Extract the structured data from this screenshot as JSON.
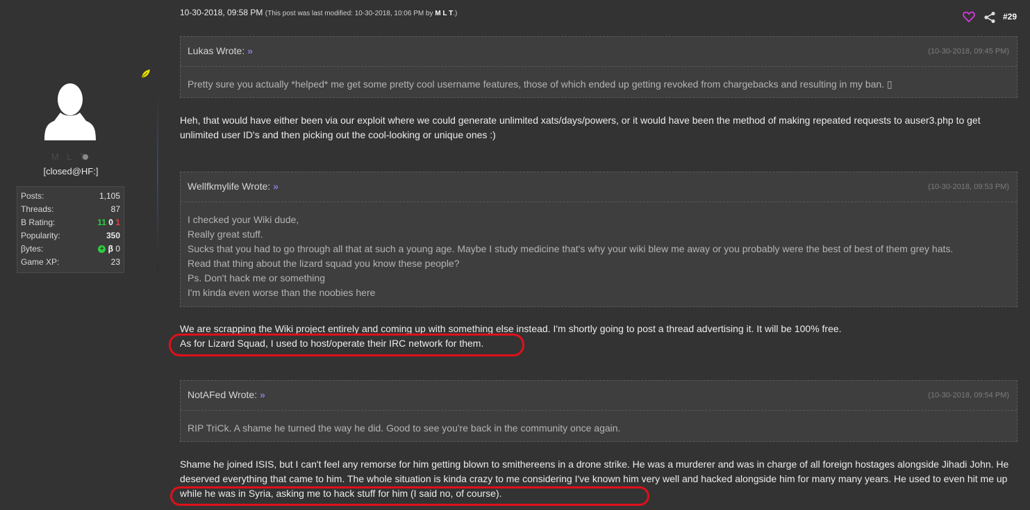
{
  "user": {
    "name": "M L T",
    "title": "[closed@HF:]",
    "stats": [
      {
        "label": "Posts:",
        "value": "1,105"
      },
      {
        "label": "Threads:",
        "value": "87"
      },
      {
        "label": "Popularity:",
        "value": "350"
      },
      {
        "label": "Game XP:",
        "value": "23"
      }
    ],
    "b_rating_label": "B Rating:",
    "b_rating": {
      "positive": "11",
      "neutral": "0",
      "negative": "1"
    },
    "bytes_label": "βytes:",
    "bytes_symbol": "β",
    "bytes_value": "0"
  },
  "post": {
    "date": "10-30-2018, 09:58 PM",
    "edit_note": "(This post was last modified: 10-30-2018, 10:06 PM by",
    "edit_by": "M L T",
    "edit_close": ".)",
    "number": "#29"
  },
  "quotes": [
    {
      "author": "Lukas Wrote:",
      "date": "(10-30-2018, 09:45 PM)",
      "lines": [
        "Pretty sure you actually *helped* me get some pretty cool username features, those of which ended up getting revoked from chargebacks and resulting in my ban.  ▯"
      ]
    },
    {
      "author": "Wellfkmylife Wrote:",
      "date": "(10-30-2018, 09:53 PM)",
      "lines": [
        "I checked your Wiki dude,",
        "Really great stuff.",
        "Sucks that you had to go through all that at such a young age. Maybe I study medicine that's why your wiki blew me away or you probably were the best of best of them grey hats.",
        "Read that thing about the lizard squad you know these people?",
        "Ps. Don't hack me or something",
        "I'm kinda even worse than the noobies here"
      ]
    },
    {
      "author": "NotAFed Wrote:",
      "date": "(10-30-2018, 09:54 PM)",
      "lines": [
        "RIP TriCk. A shame he turned the way he did. Good to see you're back in the community once again."
      ]
    }
  ],
  "replies": [
    "Heh, that would have either been via our exploit where we could generate unlimited xats/days/powers, or it would have been the method of making repeated requests to auser3.php to get unlimited user ID's and then picking out the cool-looking or unique ones :)",
    "We are scrapping the Wiki project entirely and coming up with something else instead. I'm shortly going to post a thread advertising it. It will be 100% free.",
    "As for Lizard Squad, I used to host/operate their IRC network for them.",
    "Shame he joined ISIS, but I can't feel any remorse for him getting blown to smithereens in a drone strike. He was a murderer and was in charge of all foreign hostages alongside Jihadi John. He deserved everything that came to him. The whole situation is kinda crazy to me considering I've known him very well and hacked alongside him for many many years. He used to even hit me up while he was in Syria, asking me to hack stuff for him (I said no, of course)."
  ],
  "colors": {
    "background": "#333333",
    "quote_bg": "#3e3e3e",
    "highlight": "#e0101a",
    "positive": "#2ecc40",
    "negative": "#e23b3b",
    "heart": "#d63adf",
    "quote_arrow": "#8f7bd8"
  },
  "icons": [
    "leaf-icon",
    "default-avatar-icon",
    "online-status-icon",
    "heart-icon",
    "share-icon",
    "quote-jump-icon"
  ]
}
